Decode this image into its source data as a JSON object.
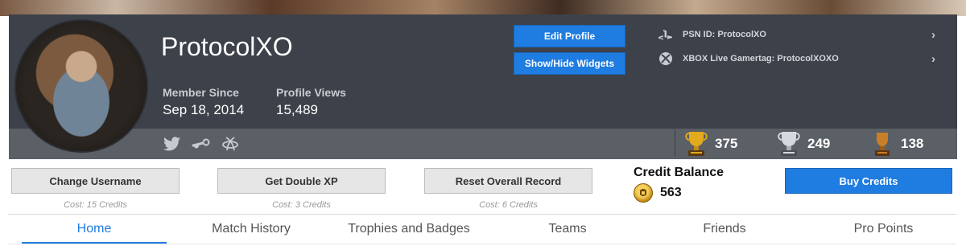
{
  "profile": {
    "username": "ProtocolXO",
    "member_since_label": "Member Since",
    "member_since_value": "Sep 18, 2014",
    "profile_views_label": "Profile Views",
    "profile_views_value": "15,489"
  },
  "header_buttons": {
    "edit_profile": "Edit Profile",
    "show_hide_widgets": "Show/Hide Widgets"
  },
  "gamer_ids": {
    "psn": "PSN ID: ProtocolXO",
    "xbox": "XBOX Live Gamertag: ProtocolXOXO"
  },
  "social_icons": [
    "twitter-icon",
    "steam-icon",
    "battlenet-icon"
  ],
  "trophies": [
    {
      "name": "gold-trophy-icon",
      "count": "375",
      "color": "#d9a21b"
    },
    {
      "name": "silver-trophy-icon",
      "count": "249",
      "color": "#c9ccd0"
    },
    {
      "name": "bronze-trophy-icon",
      "count": "138",
      "color": "#c07a2b"
    }
  ],
  "actions": [
    {
      "label": "Change Username",
      "cost": "Cost: 15 Credits"
    },
    {
      "label": "Get Double XP",
      "cost": "Cost: 3 Credits"
    },
    {
      "label": "Reset Overall Record",
      "cost": "Cost: 6 Credits"
    }
  ],
  "credits": {
    "title": "Credit Balance",
    "value": "563",
    "buy_label": "Buy Credits"
  },
  "tabs": [
    {
      "label": "Home",
      "active": true
    },
    {
      "label": "Match History",
      "active": false
    },
    {
      "label": "Trophies and Badges",
      "active": false
    },
    {
      "label": "Teams",
      "active": false
    },
    {
      "label": "Friends",
      "active": false
    },
    {
      "label": "Pro Points",
      "active": false
    }
  ],
  "colors": {
    "accent": "#1f7ce0",
    "header_bg": "#3d4149",
    "header_lower_bg": "#5b5f66"
  }
}
